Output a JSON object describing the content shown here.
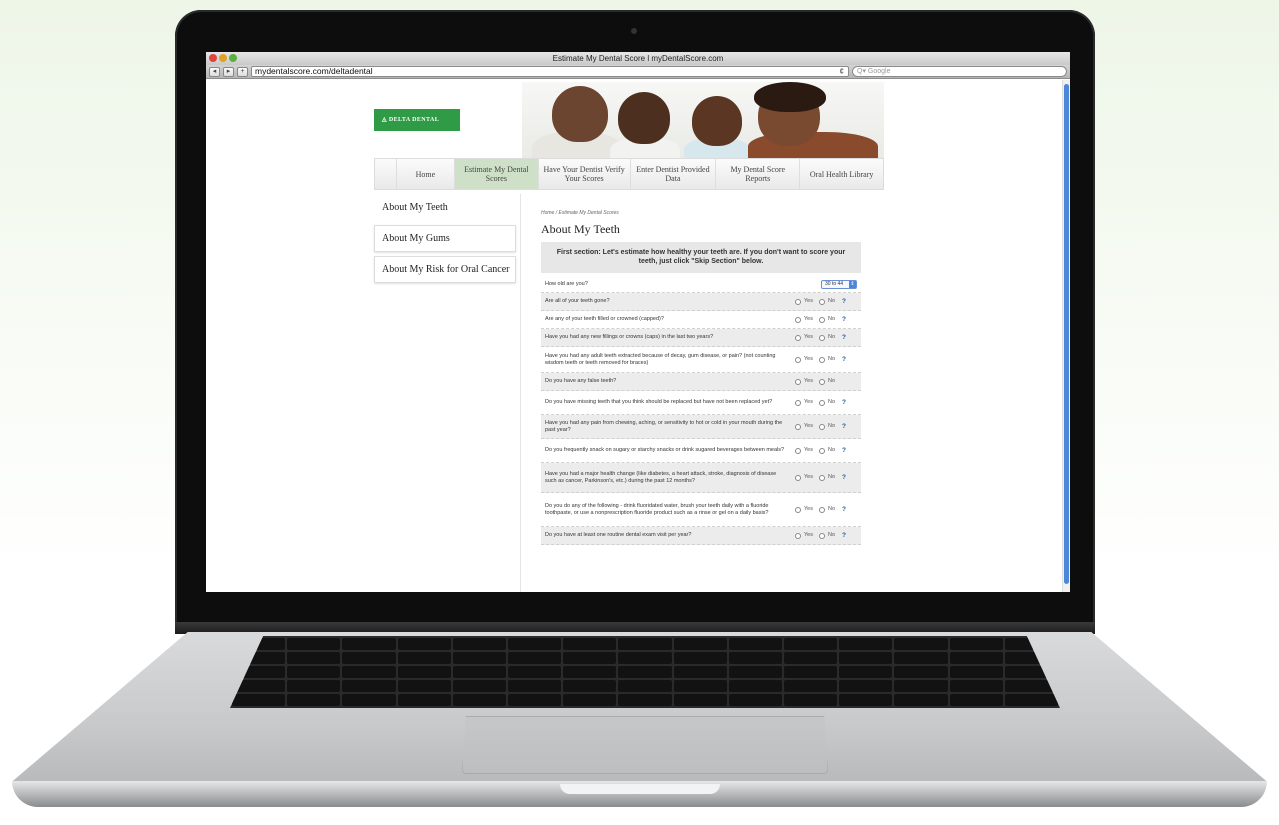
{
  "browser": {
    "title": "Estimate My Dental Score  l  myDentalScore.com",
    "url": "mydentalscore.com/deltadental",
    "search_placeholder": "Q▾ Google",
    "back_icon": "◂",
    "forward_icon": "▸",
    "add_icon": "+",
    "reload_icon": "¢"
  },
  "logo": {
    "text": "◬ DELTA DENTAL"
  },
  "nav": [
    {
      "label": "Home"
    },
    {
      "label": "Estimate My Dental Scores"
    },
    {
      "label": "Have Your Dentist Verify Your Scores"
    },
    {
      "label": "Enter Dentist Provided Data"
    },
    {
      "label": "My Dental Score Reports"
    },
    {
      "label": "Oral Health Library"
    }
  ],
  "sidebar": [
    {
      "label": "About My Teeth"
    },
    {
      "label": "About My Gums"
    },
    {
      "label": "About My Risk for Oral Cancer"
    }
  ],
  "content": {
    "breadcrumb": "Home / Estimate My Dental Scores",
    "title": "About My Teeth",
    "intro": "First section: Let's estimate how healthy your teeth are. If you don't want to score your teeth, just click \"Skip Section\" below.",
    "age_question": "How old are you?",
    "age_value": "30 to 44",
    "yes_label": "Yes",
    "no_label": "No",
    "help_label": "?",
    "questions": [
      "Are all of your teeth gone?",
      "Are any of your teeth filled or crowned (capped)?",
      "Have you had any new fillings or crowns (caps) in the last two years?",
      "Have you had any adult teeth extracted because of decay, gum disease, or pain? (not counting wisdom teeth or teeth removed for braces)",
      "Do you have any false teeth?",
      "Do you have missing teeth that you think should be replaced but have not been replaced yet?",
      "Have you had any pain from chewing, aching, or sensitivity to hot or cold in your mouth during the past year?",
      "Do you frequently snack on sugary or starchy snacks or drink sugared beverages between meals?",
      "Have you had a major health change (like diabetes, a heart attack, stroke, diagnosis of disease such as cancer, Parkinson's, etc.) during the past 12 months?",
      "Do you do any of the following - drink fluoridated water, brush your teeth daily with a fluoride toothpaste, or use a nonprescription fluoride product such as a rinse or gel on a daily basis?",
      "Do you have at least one routine dental exam visit per year?"
    ]
  },
  "colors": {
    "brand_green": "#2f9b47",
    "nav_active": "#cfe0c8",
    "link_blue": "#2a4fa8"
  }
}
